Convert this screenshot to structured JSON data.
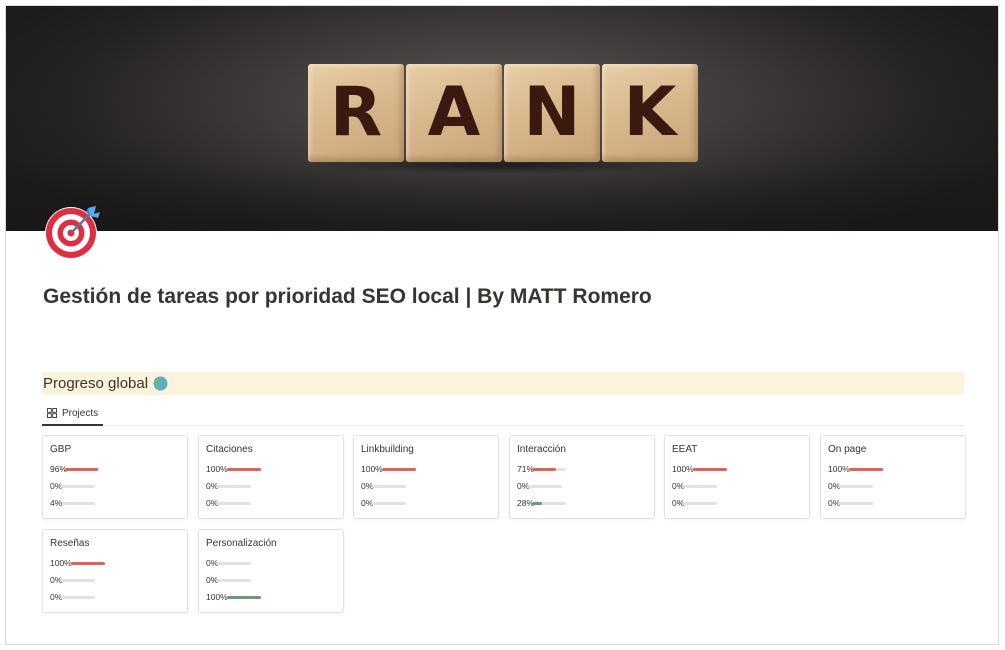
{
  "cover": {
    "letters": [
      "R",
      "A",
      "N",
      "K"
    ]
  },
  "page": {
    "icon": "target-dart-icon",
    "title": "Gestión de tareas por prioridad SEO local | By MATT Romero"
  },
  "section": {
    "title": "Progreso global",
    "icon": "globe-icon"
  },
  "view": {
    "tab_label": "Projects",
    "tab_icon": "gallery-grid-icon"
  },
  "colors": {
    "progress_red": "#e16259",
    "progress_green": "#6b9a77",
    "track": "#e3e2e0",
    "section_bg": "#fbf3db"
  },
  "cards": [
    {
      "title": "GBP",
      "bars": [
        {
          "label": "96%",
          "value": 0.96,
          "color": "red"
        },
        {
          "label": "0%",
          "value": 0,
          "color": "red"
        },
        {
          "label": "4%",
          "value": 0.04,
          "color": "red"
        }
      ]
    },
    {
      "title": "Citaciones",
      "bars": [
        {
          "label": "100%",
          "value": 1,
          "color": "red"
        },
        {
          "label": "0%",
          "value": 0,
          "color": "red"
        },
        {
          "label": "0%",
          "value": 0,
          "color": "red"
        }
      ]
    },
    {
      "title": "Linkbuilding",
      "bars": [
        {
          "label": "100%",
          "value": 1,
          "color": "red"
        },
        {
          "label": "0%",
          "value": 0,
          "color": "red"
        },
        {
          "label": "0%",
          "value": 0,
          "color": "red"
        }
      ]
    },
    {
      "title": "Interacción",
      "bars": [
        {
          "label": "71%",
          "value": 0.71,
          "color": "red"
        },
        {
          "label": "0%",
          "value": 0,
          "color": "red"
        },
        {
          "label": "28%",
          "value": 0.28,
          "color": "green"
        }
      ]
    },
    {
      "title": "EEAT",
      "bars": [
        {
          "label": "100%",
          "value": 1,
          "color": "red"
        },
        {
          "label": "0%",
          "value": 0,
          "color": "red"
        },
        {
          "label": "0%",
          "value": 0,
          "color": "red"
        }
      ]
    },
    {
      "title": "On page",
      "bars": [
        {
          "label": "100%",
          "value": 1,
          "color": "red"
        },
        {
          "label": "0%",
          "value": 0,
          "color": "red"
        },
        {
          "label": "0%",
          "value": 0,
          "color": "red"
        }
      ]
    },
    {
      "title": "Reseñas",
      "bars": [
        {
          "label": "100%",
          "value": 1,
          "color": "red"
        },
        {
          "label": "0%",
          "value": 0,
          "color": "red"
        },
        {
          "label": "0%",
          "value": 0,
          "color": "red"
        }
      ]
    },
    {
      "title": "Personalización",
      "bars": [
        {
          "label": "0%",
          "value": 0,
          "color": "red"
        },
        {
          "label": "0%",
          "value": 0,
          "color": "red"
        },
        {
          "label": "100%",
          "value": 1,
          "color": "green"
        }
      ]
    }
  ]
}
